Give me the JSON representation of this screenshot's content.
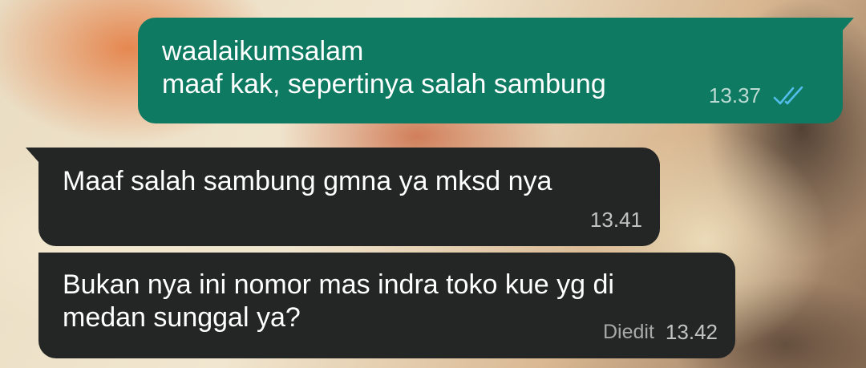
{
  "messages": [
    {
      "direction": "outgoing",
      "lines": [
        "waalaikumsalam",
        "maaf kak, sepertinya salah sambung"
      ],
      "time": "13.37",
      "status_icon": "double-check-read-icon",
      "status_color": "#53bdeb"
    },
    {
      "direction": "incoming",
      "lines": [
        "Maaf salah sambung gmna ya mksd nya"
      ],
      "time": "13.41"
    },
    {
      "direction": "incoming",
      "lines": [
        "Bukan nya ini nomor mas indra toko kue yg di",
        "medan sunggal ya?"
      ],
      "edited_label": "Diedit",
      "time": "13.42"
    }
  ],
  "colors": {
    "outgoing_bubble": "#0e7a62",
    "incoming_bubble": "#232625",
    "text": "#ffffff"
  }
}
